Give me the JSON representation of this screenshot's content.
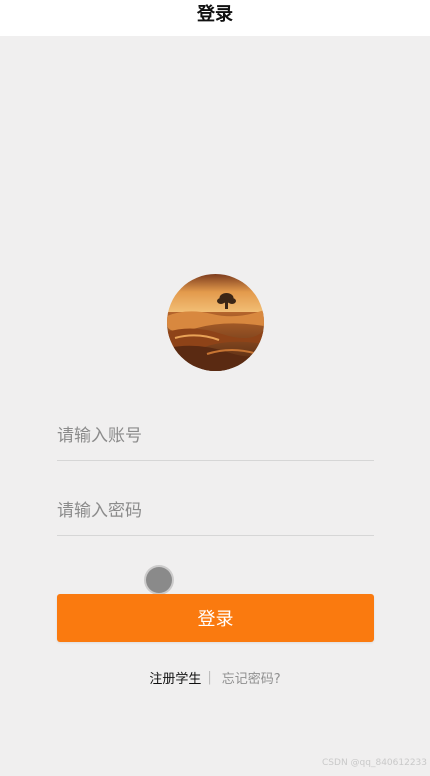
{
  "navbar": {
    "title": "登录"
  },
  "avatar": {
    "icon": "landscape-avatar"
  },
  "form": {
    "account_placeholder": "请输入账号",
    "account_value": "",
    "password_placeholder": "请输入密码",
    "password_value": "",
    "login_label": "登录"
  },
  "links": {
    "register_label": "注册学生",
    "divider": "|",
    "forgot_label": "忘记密码?"
  },
  "watermark": "CSDN @qq_840612233",
  "colors": {
    "accent": "#fa7a0f",
    "background": "#f0efef",
    "navbar": "#ffffff"
  }
}
